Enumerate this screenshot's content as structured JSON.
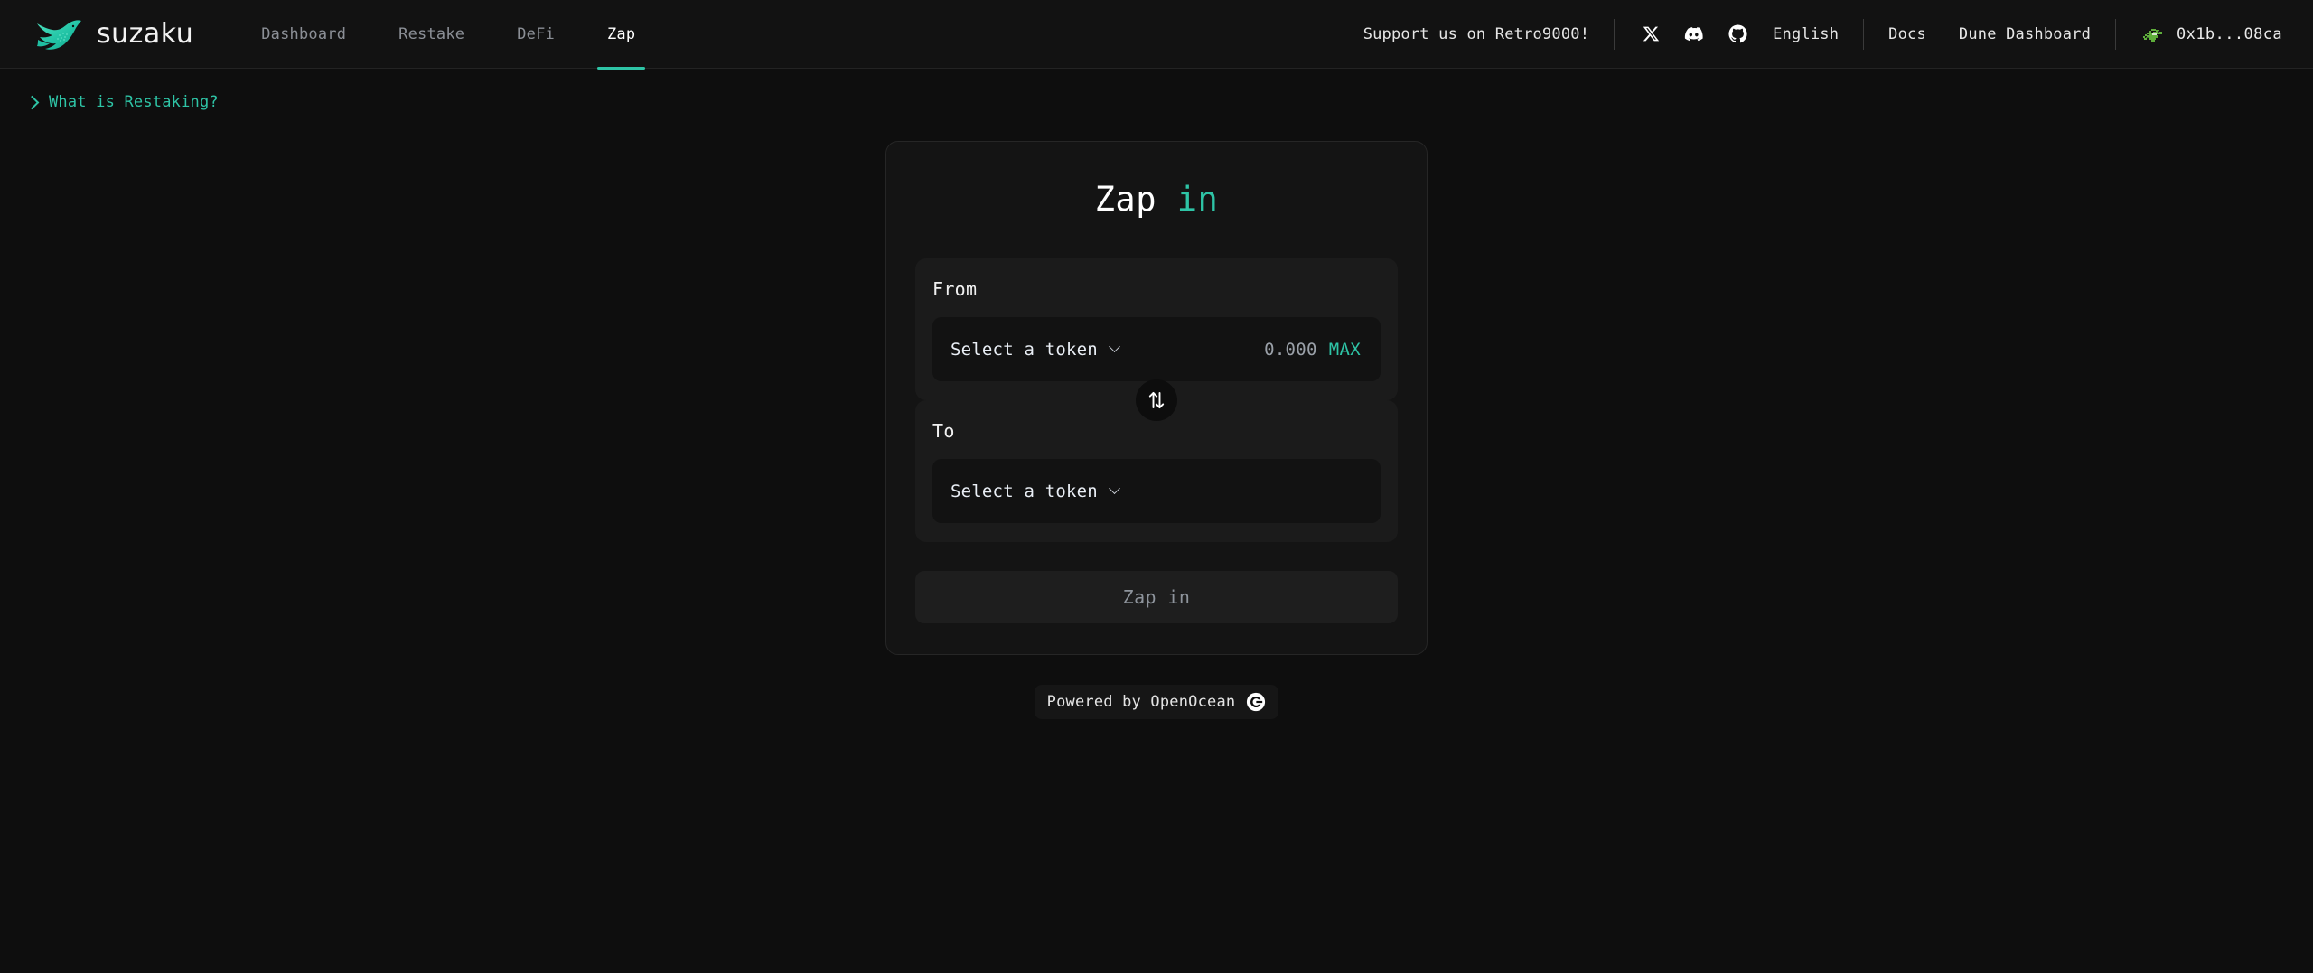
{
  "brand": {
    "name": "suzaku",
    "logo_icon": "phoenix-bird-icon"
  },
  "nav": {
    "links": [
      {
        "label": "Dashboard",
        "active": false
      },
      {
        "label": "Restake",
        "active": false
      },
      {
        "label": "DeFi",
        "active": false
      },
      {
        "label": "Zap",
        "active": true
      }
    ],
    "support_label": "Support us on Retro9000!",
    "socials": [
      {
        "name": "x-twitter-icon"
      },
      {
        "name": "discord-icon"
      },
      {
        "name": "github-icon"
      }
    ],
    "language": "English",
    "external_links": [
      {
        "label": "Docs"
      },
      {
        "label": "Dune Dashboard"
      }
    ],
    "wallet": {
      "address": "0x1b...08ca",
      "avatar_icon": "wallet-avatar-icon"
    }
  },
  "restaking": {
    "label": "What is Restaking?",
    "expanded": false,
    "accent_color": "#2ec4a6"
  },
  "zap": {
    "title_main": "Zap",
    "title_accent": "in",
    "from": {
      "label": "From",
      "token_placeholder": "Select a token",
      "balance": "0.000",
      "max_label": "MAX"
    },
    "swap_icon": "swap-vertical-arrows-icon",
    "to": {
      "label": "To",
      "token_placeholder": "Select a token"
    },
    "submit_label": "Zap in",
    "submit_disabled": true
  },
  "footer": {
    "powered_by": "Powered by OpenOcean",
    "logo_icon": "openocean-logo-icon"
  },
  "theme": {
    "background": "#0e0e0e",
    "navbar": "#121212",
    "card": "#141414",
    "panel": "#1b1b1b",
    "field": "#121212",
    "accent": "#2ec4a6",
    "muted_text": "#8b8f96"
  }
}
